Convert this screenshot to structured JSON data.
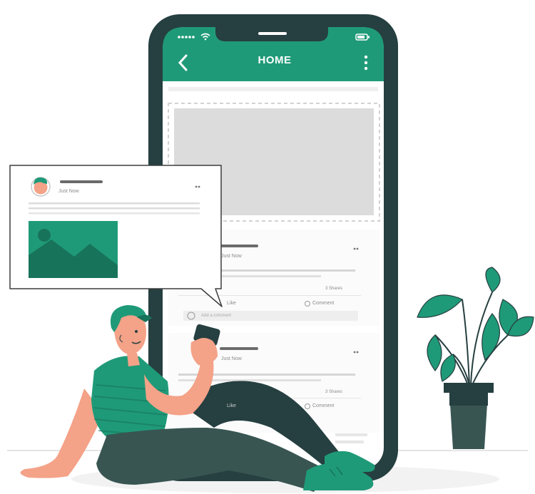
{
  "app": {
    "title": "HOME",
    "back_icon": "chevron-left-icon",
    "menu_icon": "more-vertical-icon",
    "wifi_icon": "wifi-icon",
    "battery_icon": "battery-icon"
  },
  "feed": {
    "posts": [
      {
        "timestamp": "Just Now",
        "like_label": "Like",
        "comment_label": "Comment",
        "shares": "3 Shares",
        "comment_placeholder": "Add a comment"
      },
      {
        "timestamp": "Just Now",
        "like_label": "Like",
        "comment_label": "Comment",
        "shares": "3 Shares"
      }
    ]
  },
  "popup_post": {
    "timestamp": "Just Now"
  },
  "colors": {
    "brand_green": "#1f9a78",
    "dark_green": "#17735a",
    "phone_frame": "#263f40",
    "skin": "#f4a288",
    "pants": "#385552",
    "placeholder_grey": "#dcdcdc"
  }
}
